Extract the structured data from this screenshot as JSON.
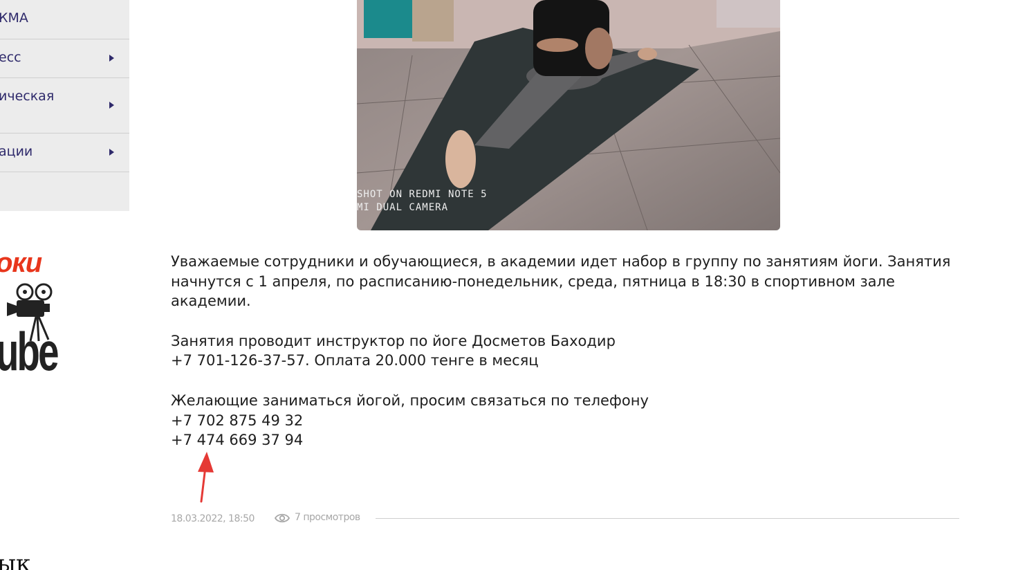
{
  "sidebar": {
    "items": [
      {
        "label": "КМА",
        "has_arrow": false
      },
      {
        "label": "есс",
        "has_arrow": true
      },
      {
        "label": "ическая",
        "has_arrow": true
      },
      {
        "label": "ации",
        "has_arrow": true
      },
      {
        "label": "",
        "has_arrow": false
      }
    ]
  },
  "logo": {
    "top_text": "оки",
    "bottom_text": "ube",
    "colors": {
      "accent": "#e8361c",
      "dark": "#222222"
    }
  },
  "photo": {
    "caption_line1": "SHOT ON REDMI NOTE 5",
    "caption_line2": "MI DUAL CAMERA"
  },
  "article": {
    "paragraph1": "Уважаемые сотрудники и обучающиеся, в академии идет набор в группу по занятиям йоги. Занятия начнутся с 1 апреля, по расписанию-понедельник, среда, пятница в 18:30 в спортивном зале академии.",
    "instructor_line": "Занятия проводит инструктор по йоге Досметов Баходир",
    "price_line": "+7 701-126-37-57. Оплата 20.000 тенге в месяц",
    "contact_line": "Желающие заниматься йогой, просим связаться по телефону",
    "phone1": "+7 702 875 49 32",
    "phone2": "+7 474 669 37 94"
  },
  "meta": {
    "date": "18.03.2022, 18:50",
    "views": "7 просмотров"
  },
  "bottom": {
    "partial_text": "ык"
  },
  "colors": {
    "nav_text": "#2f2a6b",
    "sidebar_bg": "#ececec",
    "annotation_arrow": "#e53935",
    "meta_text": "#a7a7a7"
  }
}
